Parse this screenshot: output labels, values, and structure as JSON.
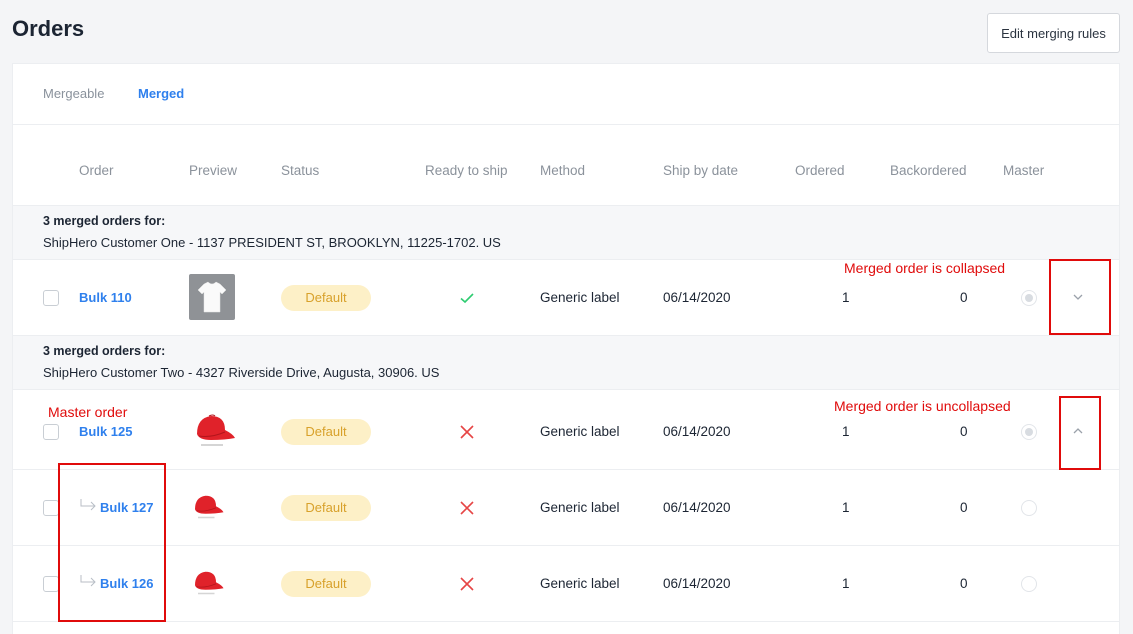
{
  "page": {
    "title": "Orders",
    "edit_button": "Edit merging rules"
  },
  "tabs": [
    {
      "label": "Mergeable",
      "active": false
    },
    {
      "label": "Merged",
      "active": true
    }
  ],
  "columns": [
    "Order",
    "Preview",
    "Status",
    "Ready to ship",
    "Method",
    "Ship by date",
    "Ordered",
    "Backordered",
    "Master"
  ],
  "groups": [
    {
      "title": "3 merged orders for:",
      "address": "ShipHero Customer One - 1137 PRESIDENT ST, BROOKLYN, 11225-1702. US",
      "rows": [
        {
          "order": "Bulk 110",
          "preview": "white-tshirt-icon",
          "status": "Default",
          "ready": "check",
          "method": "Generic label",
          "date": "06/14/2020",
          "ordered": "1",
          "backordered": "0",
          "master": true,
          "expander": "chevron-down"
        }
      ]
    },
    {
      "title": "3 merged orders for:",
      "address": "ShipHero Customer Two - 4327 Riverside Drive, Augusta, 30906. US",
      "rows": [
        {
          "order": "Bulk 125",
          "preview": "red-cap-icon",
          "status": "Default",
          "ready": "cross",
          "method": "Generic label",
          "date": "06/14/2020",
          "ordered": "1",
          "backordered": "0",
          "master": true,
          "expander": "chevron-up"
        },
        {
          "order": "Bulk 127",
          "preview": "red-cap-icon",
          "status": "Default",
          "ready": "cross",
          "method": "Generic label",
          "date": "06/14/2020",
          "ordered": "1",
          "backordered": "0",
          "master": false,
          "child": true
        },
        {
          "order": "Bulk 126",
          "preview": "red-cap-icon",
          "status": "Default",
          "ready": "cross",
          "method": "Generic label",
          "date": "06/14/2020",
          "ordered": "1",
          "backordered": "0",
          "master": false,
          "child": true
        }
      ]
    }
  ],
  "annotations": {
    "collapsed": "Merged order is collapsed",
    "uncollapsed": "Merged order is uncollapsed",
    "master": "Master order"
  },
  "colors": {
    "accent": "#2f80ed",
    "badge_bg": "#fdf0c7",
    "badge_text": "#d8a12b",
    "check": "#2ecc71",
    "cross": "#e64545",
    "annotation": "#e00b0b"
  }
}
